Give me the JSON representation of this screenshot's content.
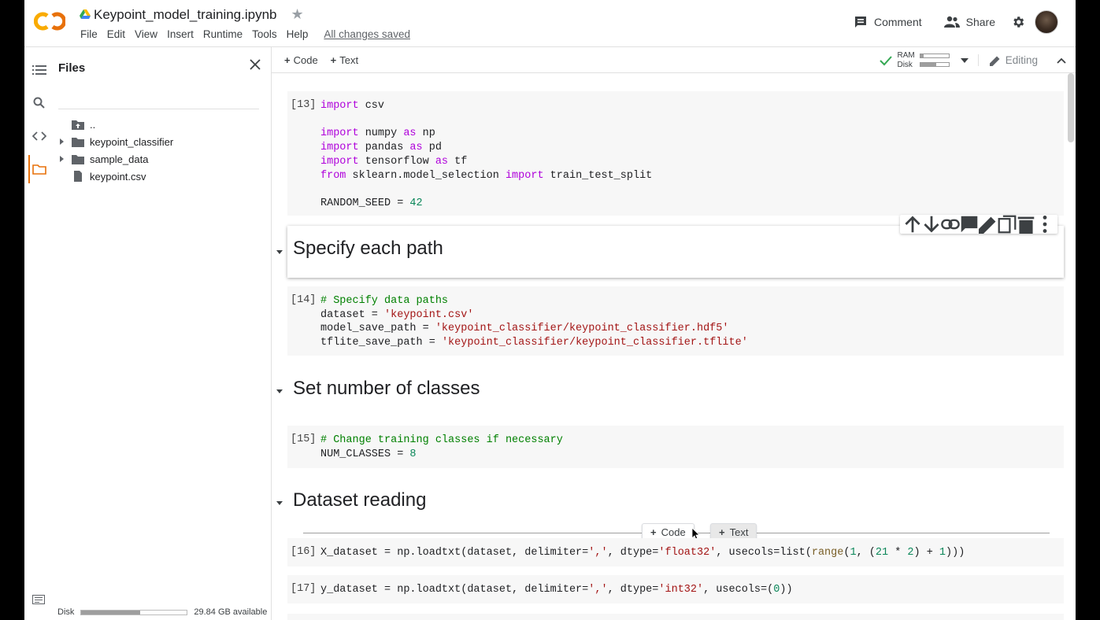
{
  "header": {
    "doc_title": "Keypoint_model_training.ipynb",
    "menu": [
      "File",
      "Edit",
      "View",
      "Insert",
      "Runtime",
      "Tools",
      "Help"
    ],
    "save_status": "All changes saved",
    "comment_label": "Comment",
    "share_label": "Share"
  },
  "files_panel": {
    "title": "Files",
    "items": [
      {
        "name": "..",
        "type": "parent"
      },
      {
        "name": "keypoint_classifier",
        "type": "folder"
      },
      {
        "name": "sample_data",
        "type": "folder"
      },
      {
        "name": "keypoint.csv",
        "type": "file"
      }
    ],
    "disk_label": "Disk",
    "disk_available": "29.84 GB available",
    "disk_used_fraction": 0.56
  },
  "toolbar": {
    "add_code": "Code",
    "add_text": "Text",
    "ram_label": "RAM",
    "disk_label": "Disk",
    "ram_used_fraction": 0.12,
    "disk_used_fraction": 0.55,
    "editing_label": "Editing"
  },
  "cells": {
    "c13": {
      "exec": "[13]"
    },
    "md1": {
      "heading": "Specify each path"
    },
    "c14": {
      "exec": "[14]"
    },
    "md2": {
      "heading": "Set number of classes"
    },
    "c15": {
      "exec": "[15]"
    },
    "md3": {
      "heading": "Dataset reading"
    },
    "c16": {
      "exec": "[16]"
    },
    "c17": {
      "exec": "[17]"
    }
  },
  "insert_bar": {
    "code_label": "Code",
    "text_label": "Text"
  },
  "colors": {
    "accent": "#e8710a",
    "keyword": "#af00db",
    "string": "#a31515",
    "number": "#098658",
    "comment": "#008000"
  }
}
